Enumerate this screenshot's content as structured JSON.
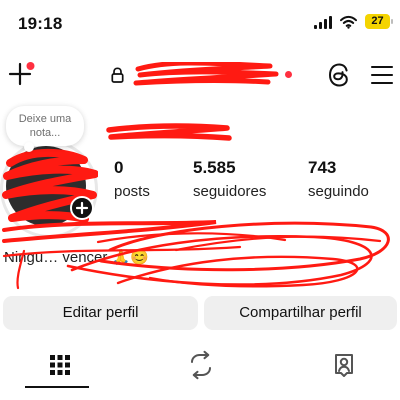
{
  "status_bar": {
    "time": "19:18",
    "battery": "27"
  },
  "header": {
    "icons": [
      "plus-icon",
      "lock-icon",
      "threads-icon",
      "menu-icon"
    ],
    "notification_dot_color": "#ff3040"
  },
  "profile": {
    "note_placeholder": "Deixe uma nota...",
    "stats": [
      {
        "value": "0",
        "label": "posts"
      },
      {
        "value": "5.585",
        "label": "seguidores"
      },
      {
        "value": "743",
        "label": "seguindo"
      }
    ],
    "bio_visible": "Ningu… vencer 🙏😊"
  },
  "actions": {
    "edit_profile": "Editar perfil",
    "share_profile": "Compartilhar perfil"
  },
  "tabs": [
    {
      "name": "grid-icon",
      "selected": true
    },
    {
      "name": "reels-icon",
      "selected": false
    },
    {
      "name": "tagged-icon",
      "selected": false
    }
  ],
  "colors": {
    "redaction": "#ff1a12",
    "button_bg": "#efefef"
  }
}
